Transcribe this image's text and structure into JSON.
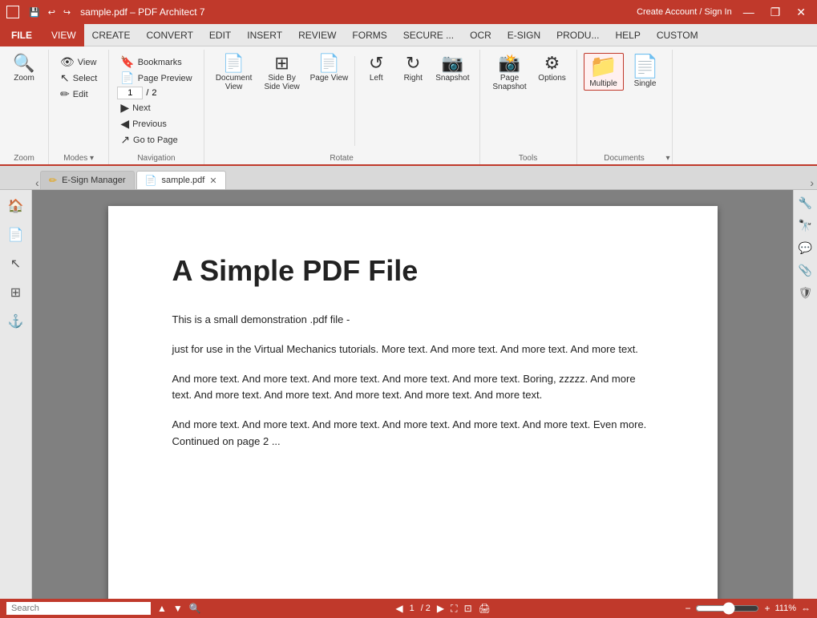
{
  "titleBar": {
    "title": "sample.pdf  –  PDF Architect 7",
    "createAccount": "Create Account / Sign In",
    "controls": {
      "minimize": "—",
      "restore": "❐",
      "close": "✕"
    }
  },
  "menuBar": {
    "items": [
      "FILE",
      "VIEW",
      "CREATE",
      "CONVERT",
      "EDIT",
      "INSERT",
      "REVIEW",
      "FORMS",
      "SECURE ...",
      "OCR",
      "E-SIGN",
      "PRODU...",
      "HELP",
      "CUSTOM"
    ]
  },
  "ribbon": {
    "groups": {
      "zoom": {
        "label": "Zoom",
        "buttons": [
          {
            "id": "zoom",
            "icon": "🔍",
            "label": "Zoom"
          }
        ]
      },
      "navigation": {
        "label": "Navigation",
        "buttons": [
          {
            "id": "bookmarks",
            "icon": "🔖",
            "label": "Bookmarks"
          },
          {
            "id": "page-preview",
            "icon": "📄",
            "label": "Page Preview"
          },
          {
            "id": "next",
            "icon": "▶",
            "label": "Next"
          },
          {
            "id": "previous",
            "icon": "◀",
            "label": "Previous"
          },
          {
            "id": "goto-page",
            "icon": "↗",
            "label": "Go to Page"
          }
        ],
        "pageInputValue": "1",
        "pageTotal": "2"
      },
      "modes": {
        "label": "Modes",
        "buttons": [
          {
            "id": "view",
            "icon": "👁",
            "label": "View"
          },
          {
            "id": "select",
            "icon": "↖",
            "label": "Select"
          },
          {
            "id": "edit",
            "icon": "✏",
            "label": "Edit"
          }
        ]
      },
      "rotate": {
        "label": "Rotate",
        "buttons": [
          {
            "id": "document-view",
            "icon": "📄",
            "label": "Document View"
          },
          {
            "id": "side-by-side",
            "icon": "⊞",
            "label": "Side By Side View"
          },
          {
            "id": "page-view",
            "icon": "📄",
            "label": "Page View"
          },
          {
            "id": "left",
            "icon": "↺",
            "label": "Left"
          },
          {
            "id": "right",
            "icon": "↻",
            "label": "Right"
          },
          {
            "id": "snapshot",
            "icon": "📷",
            "label": "Snapshot"
          }
        ]
      },
      "tools": {
        "label": "Tools",
        "buttons": [
          {
            "id": "page-snapshot",
            "icon": "📸",
            "label": "Page Snapshot"
          },
          {
            "id": "options",
            "icon": "⚙",
            "label": "Options"
          }
        ]
      },
      "documents": {
        "label": "Documents",
        "buttons": [
          {
            "id": "multiple",
            "icon": "📁",
            "label": "Multiple",
            "active": true
          },
          {
            "id": "single",
            "icon": "📄",
            "label": "Single"
          }
        ]
      }
    }
  },
  "tabs": {
    "items": [
      {
        "id": "esign-manager",
        "label": "E-Sign Manager",
        "icon": "✏",
        "closable": false
      },
      {
        "id": "sample-pdf",
        "label": "sample.pdf",
        "icon": "📄",
        "closable": true,
        "active": true
      }
    ]
  },
  "leftSidebar": {
    "buttons": [
      {
        "id": "home",
        "icon": "🏠"
      },
      {
        "id": "pages",
        "icon": "📄"
      },
      {
        "id": "cursor",
        "icon": "↖"
      },
      {
        "id": "layers",
        "icon": "⊞"
      },
      {
        "id": "anchor",
        "icon": "⚓"
      }
    ]
  },
  "rightSidebar": {
    "buttons": [
      {
        "id": "wrench",
        "icon": "🔧"
      },
      {
        "id": "binoculars",
        "icon": "🔭"
      },
      {
        "id": "comment",
        "icon": "💬"
      },
      {
        "id": "paperclip",
        "icon": "📎"
      },
      {
        "id": "shield",
        "icon": "🛡"
      }
    ]
  },
  "pdfContent": {
    "title": "A Simple PDF File",
    "paragraphs": [
      "This is a small demonstration .pdf file -",
      "just for use in the Virtual Mechanics tutorials. More text. And more text. And more text. And more text.",
      "And more text. And more text. And more text. And more text. And more text. Boring, zzzzz. And more text. And more text. And more text. And more text. And more text. And more text.",
      "And more text. And more text. And more text. And more text. And more text. And more text. Even more. Continued on page 2 ..."
    ]
  },
  "statusBar": {
    "searchPlaceholder": "Search",
    "pageInfo": "1",
    "pageSep": "/ 2",
    "zoomLevel": "111%"
  }
}
